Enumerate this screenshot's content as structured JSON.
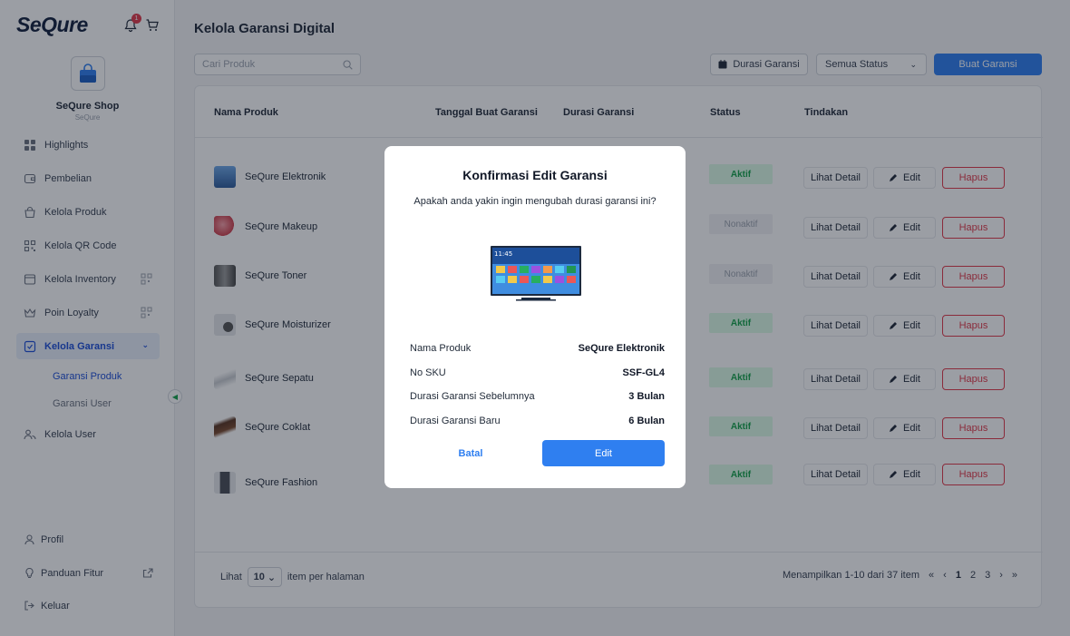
{
  "brand": {
    "logo": "SeQure",
    "notification_count": "1"
  },
  "shop": {
    "name": "SeQure Shop",
    "sub": "SeQure"
  },
  "sidebar": {
    "items": [
      {
        "label": "Highlights",
        "icon": "grid-icon"
      },
      {
        "label": "Pembelian",
        "icon": "wallet-icon"
      },
      {
        "label": "Kelola Produk",
        "icon": "bag-icon"
      },
      {
        "label": "Kelola QR Code",
        "icon": "qr-icon"
      },
      {
        "label": "Kelola Inventory",
        "icon": "inbox-icon"
      },
      {
        "label": "Poin Loyalty",
        "icon": "crown-icon"
      },
      {
        "label": "Kelola Garansi",
        "icon": "warranty-icon"
      },
      {
        "label": "Kelola User",
        "icon": "users-icon"
      }
    ],
    "sub_items": [
      "Garansi Produk",
      "Garansi User"
    ],
    "bottom": [
      "Profil",
      "Panduan Fitur",
      "Keluar"
    ]
  },
  "header": {
    "title": "Kelola Garansi Digital",
    "search_placeholder": "Cari Produk",
    "durasi_label": "Durasi Garansi",
    "status_select": "Semua Status",
    "buat_label": "Buat Garansi"
  },
  "table": {
    "columns": [
      "Nama Produk",
      "Tanggal Buat Garansi",
      "Durasi Garansi",
      "Status",
      "Tindakan"
    ],
    "rows": [
      {
        "name": "SeQure Elektronik",
        "status": "Aktif"
      },
      {
        "name": "SeQure Makeup",
        "status": "Nonaktif"
      },
      {
        "name": "SeQure Toner",
        "status": "Nonaktif"
      },
      {
        "name": "SeQure Moisturizer",
        "status": "Aktif"
      },
      {
        "name": "SeQure Sepatu",
        "status": "Aktif"
      },
      {
        "name": "SeQure Coklat",
        "status": "Aktif"
      },
      {
        "name": "SeQure Fashion",
        "status": "Aktif"
      }
    ],
    "actions": {
      "detail": "Lihat Detail",
      "edit": "Edit",
      "hapus": "Hapus"
    }
  },
  "footer": {
    "lihat": "Lihat",
    "per_page": "10",
    "per_page_suffix": "item per halaman",
    "showing": "Menampilkan 1-10 dari 37 item",
    "pages": [
      "1",
      "2",
      "3"
    ]
  },
  "modal": {
    "title": "Konfirmasi Edit Garansi",
    "description": "Apakah anda yakin ingin mengubah durasi garansi ini?",
    "image_screen_time": "11:45",
    "fields": [
      {
        "label": "Nama Produk",
        "value": "SeQure Elektronik"
      },
      {
        "label": "No SKU",
        "value": "SSF-GL4"
      },
      {
        "label": "Durasi Garansi Sebelumnya",
        "value": "3 Bulan"
      },
      {
        "label": "Durasi Garansi Baru",
        "value": "6 Bulan"
      }
    ],
    "cancel": "Batal",
    "confirm": "Edit"
  },
  "colors": {
    "primary": "#2f7ff0",
    "danger": "#e23a4a",
    "success": "#16a34a"
  }
}
